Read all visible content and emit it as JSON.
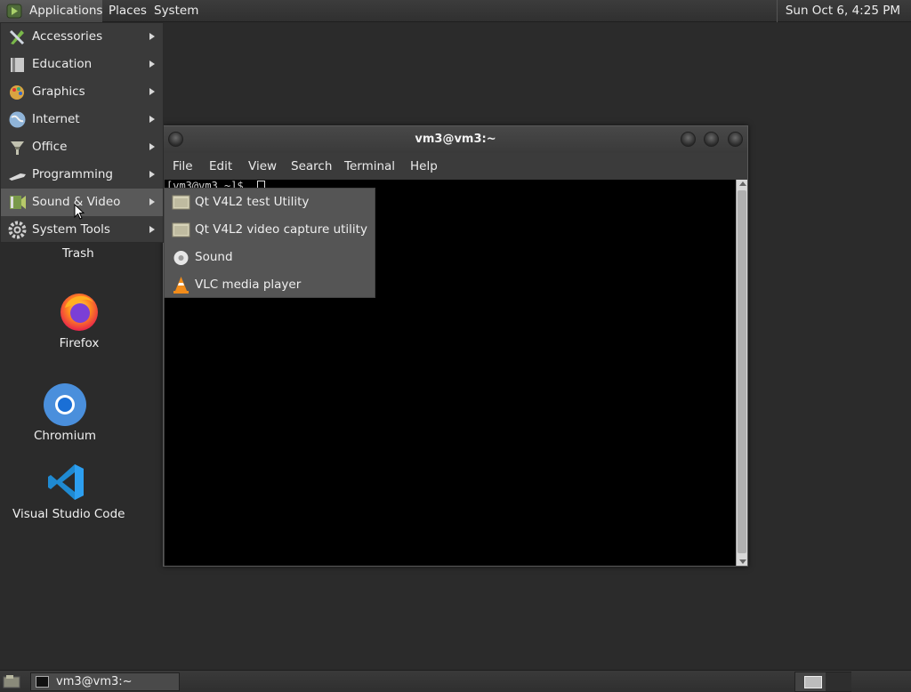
{
  "top_panel": {
    "applications": "Applications",
    "places": "Places",
    "system": "System",
    "clock": "Sun Oct  6,  4:25 PM"
  },
  "apps_menu": {
    "items": [
      {
        "label": "Accessories",
        "icon": "accessories-icon"
      },
      {
        "label": "Education",
        "icon": "education-icon"
      },
      {
        "label": "Graphics",
        "icon": "graphics-icon"
      },
      {
        "label": "Internet",
        "icon": "internet-icon"
      },
      {
        "label": "Office",
        "icon": "office-icon"
      },
      {
        "label": "Programming",
        "icon": "programming-icon"
      },
      {
        "label": "Sound & Video",
        "icon": "sound-video-icon",
        "active": true
      },
      {
        "label": "System Tools",
        "icon": "system-tools-icon"
      }
    ]
  },
  "submenu": {
    "items": [
      {
        "label": "Qt V4L2 test Utility",
        "icon": "folder-icon"
      },
      {
        "label": "Qt V4L2 video capture utility",
        "icon": "folder-icon"
      },
      {
        "label": "Sound",
        "icon": "sound-icon"
      },
      {
        "label": "VLC media player",
        "icon": "vlc-cone-icon"
      }
    ]
  },
  "desktop_icons": {
    "trash": "Trash",
    "firefox": "Firefox",
    "chromium": "Chromium",
    "vscode": "Visual Studio Code"
  },
  "terminal": {
    "title": "vm3@vm3:~",
    "menu": [
      "File",
      "Edit",
      "View",
      "Search",
      "Terminal",
      "Help"
    ],
    "prompt": "[vm3@vm3 ~]$ "
  },
  "taskbar": {
    "task_label": "vm3@vm3:~"
  },
  "colors": {
    "panel_bg": "#333333",
    "desktop_bg": "#2b2b2b",
    "menu_active": "#595959",
    "submenu_bg": "#555555",
    "terminal_bg": "#000000"
  }
}
